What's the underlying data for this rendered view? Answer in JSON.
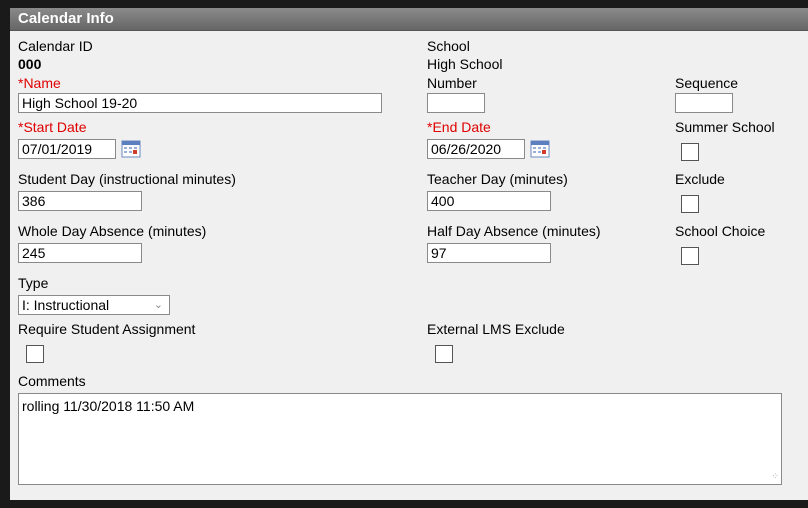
{
  "header": {
    "title": "Calendar Info"
  },
  "calendar_id": {
    "label": "Calendar ID",
    "value": "000"
  },
  "school": {
    "label": "School",
    "value": "High School"
  },
  "name": {
    "label": "*Name",
    "value": "High School 19-20"
  },
  "number": {
    "label": "Number",
    "value": ""
  },
  "sequence": {
    "label": "Sequence",
    "value": ""
  },
  "start_date": {
    "label": "*Start Date",
    "value": "07/01/2019"
  },
  "end_date": {
    "label": "*End Date",
    "value": "06/26/2020"
  },
  "summer_school": {
    "label": "Summer School",
    "checked": false
  },
  "student_day": {
    "label": "Student Day (instructional minutes)",
    "value": "386"
  },
  "teacher_day": {
    "label": "Teacher Day (minutes)",
    "value": "400"
  },
  "exclude": {
    "label": "Exclude",
    "checked": false
  },
  "whole_day_absence": {
    "label": "Whole Day Absence (minutes)",
    "value": "245"
  },
  "half_day_absence": {
    "label": "Half Day Absence (minutes)",
    "value": "97"
  },
  "school_choice": {
    "label": "School Choice",
    "checked": false
  },
  "type": {
    "label": "Type",
    "selected": "I: Instructional"
  },
  "require_student_assignment": {
    "label": "Require Student Assignment",
    "checked": false
  },
  "external_lms_exclude": {
    "label": "External LMS Exclude",
    "checked": false
  },
  "comments": {
    "label": "Comments",
    "value": "rolling 11/30/2018 11:50 AM"
  },
  "colors": {
    "required": "#e00000",
    "header_bg": "#777777",
    "panel_bg": "#f0f0f0"
  },
  "icons": {
    "calendar": "calendar-icon",
    "select": "chevron-down-icon"
  }
}
